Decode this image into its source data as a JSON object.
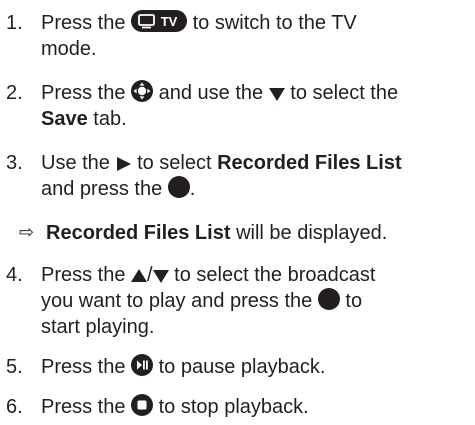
{
  "steps": [
    {
      "num": "1.",
      "t1": "Press the",
      "t2": "to switch to the TV",
      "t3": "mode."
    },
    {
      "num": "2.",
      "t1": "Press the",
      "t2": "and use the",
      "t3": "to select the",
      "bold": "Save",
      "t4": "tab."
    },
    {
      "num": "3.",
      "t1": "Use the",
      "t2": "to select",
      "bold": "Recorded Files List",
      "t3": "and press the",
      "t4": "."
    },
    {
      "num": "4.",
      "t1": "Press the",
      "t2": "to select the broadcast",
      "t3": "you want to play and press the",
      "t4": "to",
      "t5": "start playing."
    },
    {
      "num": "5.",
      "t1": "Press the",
      "t2": "to pause playback."
    },
    {
      "num": "6.",
      "t1": "Press the",
      "t2": "to stop playback."
    }
  ],
  "result": {
    "symbol": "⇨",
    "bold": "Recorded Files List",
    "text": "will be displayed."
  },
  "icons": {
    "tv_button_label": "TV",
    "tv_button": "tv-button-icon",
    "nav_button": "directional-pad-icon",
    "down_arrow": "down-arrow-icon",
    "right_arrow": "right-arrow-icon",
    "ok_button": "ok-button-icon",
    "up_arrow": "up-arrow-icon",
    "slash": "/",
    "pause_button": "play-pause-button-icon",
    "stop_button": "stop-button-icon",
    "icon_color": "#231f20"
  }
}
